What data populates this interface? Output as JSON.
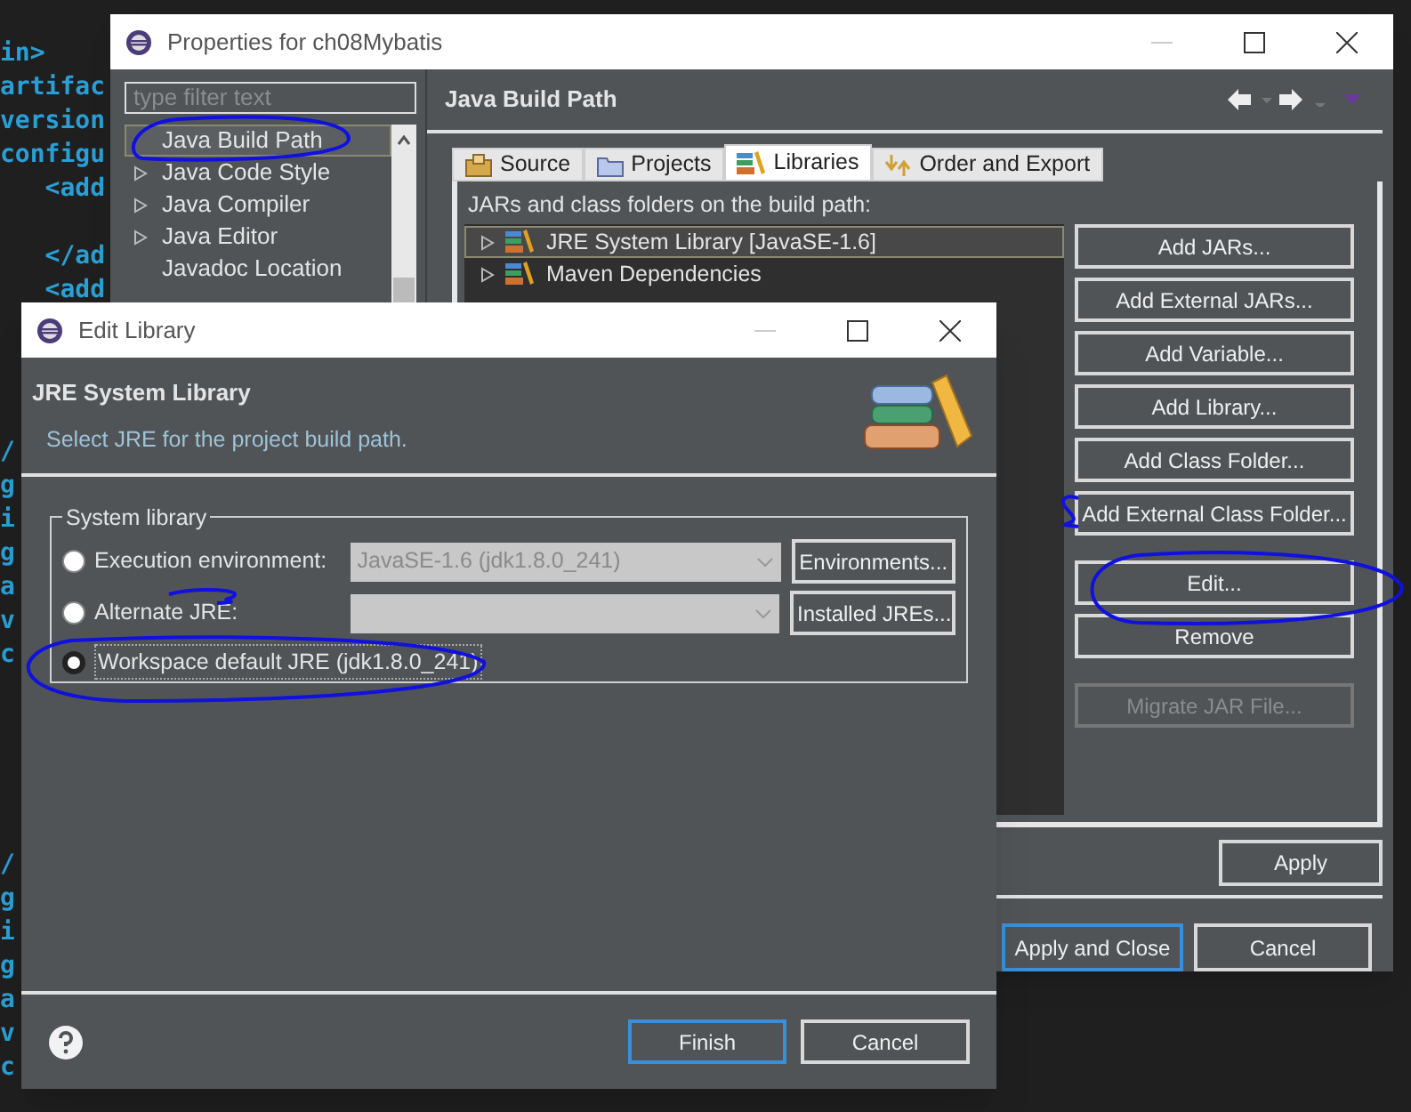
{
  "editor": {
    "lines_top": [
      "in>",
      "artifac",
      "version",
      "configu",
      "   <add"
    ],
    "lines_top_2": [
      "   </ad",
      "   <add"
    ],
    "lines_middle": [
      "/",
      "g",
      "i",
      "g",
      "a",
      "v",
      "c"
    ],
    "lines_bottom": [
      "/",
      "g",
      "i",
      "g",
      "a",
      "v",
      "c"
    ]
  },
  "properties_window": {
    "title": "Properties for ch08Mybatis",
    "filter": {
      "placeholder": "type filter text"
    },
    "nav_items": [
      {
        "label": "Java Build Path",
        "selected": true,
        "expandable": false
      },
      {
        "label": "Java Code Style",
        "selected": false,
        "expandable": true
      },
      {
        "label": "Java Compiler",
        "selected": false,
        "expandable": true
      },
      {
        "label": "Java Editor",
        "selected": false,
        "expandable": true
      },
      {
        "label": "Javadoc Location",
        "selected": false,
        "expandable": false
      }
    ],
    "page_title": "Java Build Path",
    "tabs": [
      {
        "label": "Source",
        "kind": "source",
        "selected": false
      },
      {
        "label": "Projects",
        "kind": "projects",
        "selected": false
      },
      {
        "label": "Libraries",
        "kind": "libraries",
        "selected": true
      },
      {
        "label": "Order and Export",
        "kind": "order",
        "selected": false
      }
    ],
    "list_label": "JARs and class folders on the build path:",
    "entries": [
      {
        "label": "JRE System Library [JavaSE-1.6]",
        "selected": true
      },
      {
        "label": "Maven Dependencies",
        "selected": false
      }
    ],
    "side_button_groups": [
      [
        {
          "label": "Add JARs...",
          "disabled": false
        },
        {
          "label": "Add External JARs...",
          "disabled": false
        },
        {
          "label": "Add Variable...",
          "disabled": false
        },
        {
          "label": "Add Library...",
          "disabled": false
        },
        {
          "label": "Add Class Folder...",
          "disabled": false
        },
        {
          "label": "Add External Class Folder...",
          "disabled": false
        }
      ],
      [
        {
          "label": "Edit...",
          "disabled": false
        },
        {
          "label": "Remove",
          "disabled": false
        }
      ],
      [
        {
          "label": "Migrate JAR File...",
          "disabled": true
        }
      ]
    ],
    "apply": "Apply",
    "footer_buttons": [
      {
        "label": "Apply and Close",
        "default": true
      },
      {
        "label": "Cancel",
        "default": false
      }
    ]
  },
  "edit_dialog": {
    "title": "Edit Library",
    "heading": "JRE System Library",
    "description": "Select JRE for the project build path.",
    "group_label": "System library",
    "options": [
      {
        "label": "Execution environment:",
        "selected": false,
        "combo": {
          "value": "JavaSE-1.6 (jdk1.8.0_241)",
          "disabled": true
        },
        "button": "Environments..."
      },
      {
        "label": "Alternate JRE:",
        "selected": false,
        "combo": {
          "disabled": true
        },
        "button": "Installed JREs..."
      },
      {
        "label": "Workspace default JRE (jdk1.8.0_241)",
        "selected": true
      }
    ],
    "footer_buttons": [
      {
        "label": "Finish",
        "default": true
      },
      {
        "label": "Cancel",
        "default": false
      }
    ]
  }
}
